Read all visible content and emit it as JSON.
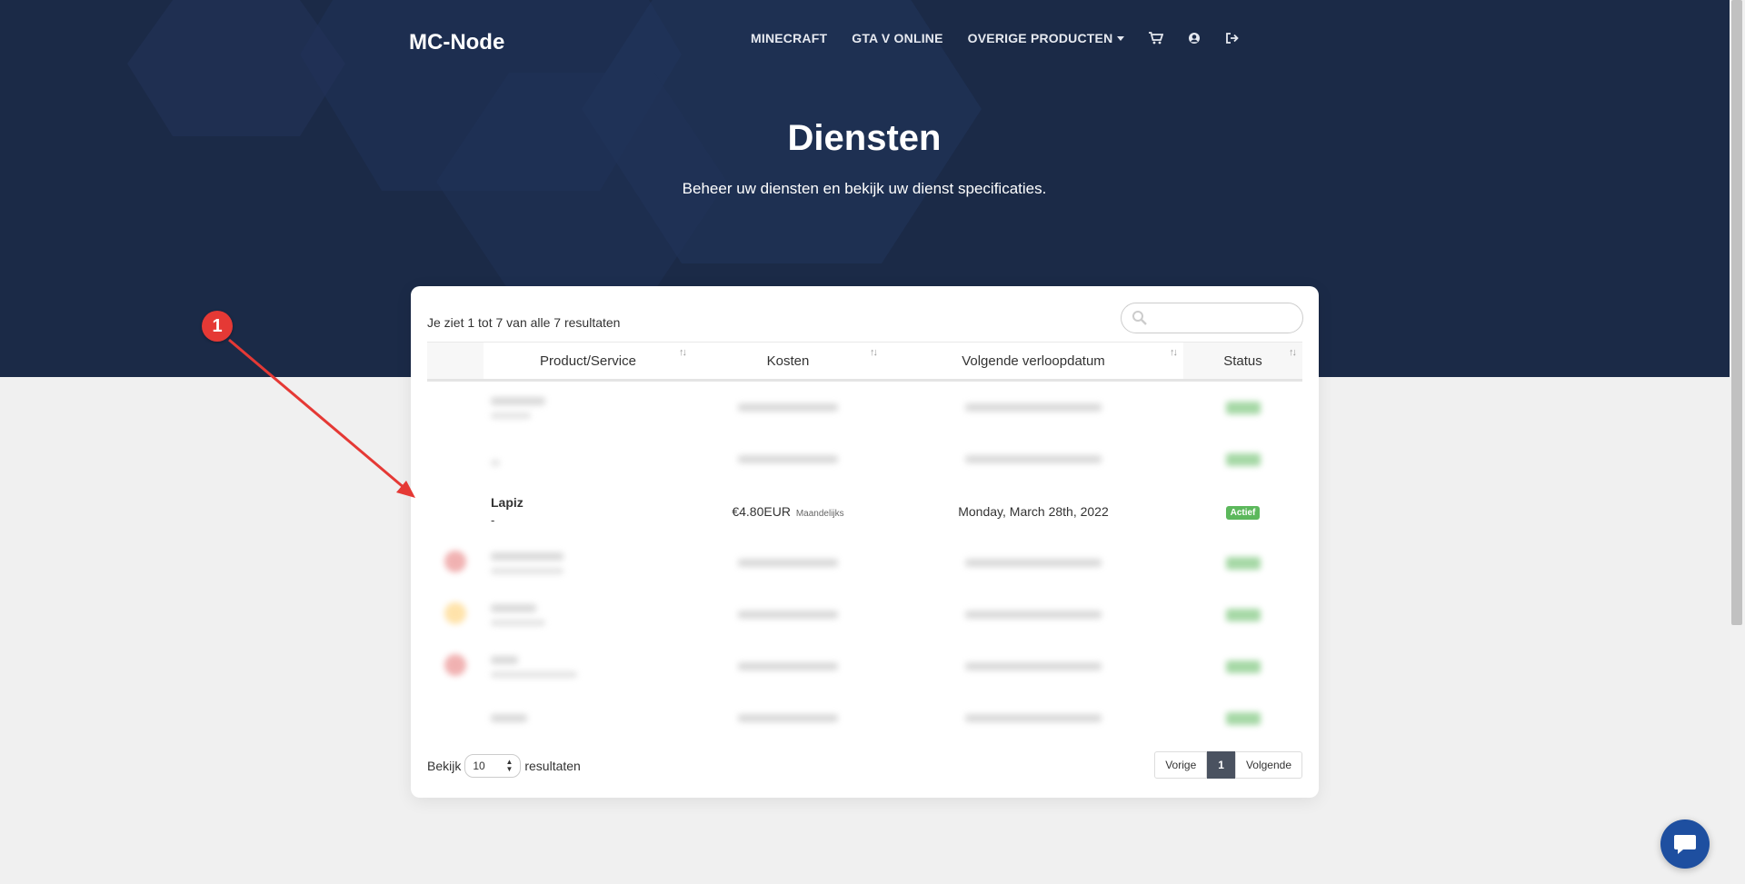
{
  "brand": "MC-Node",
  "nav": {
    "minecraft": "MINECRAFT",
    "gta": "GTA V ONLINE",
    "other": "OVERIGE PRODUCTEN",
    "icons": [
      "cart-icon",
      "user-circle-icon",
      "logout-icon"
    ]
  },
  "hero": {
    "title": "Diensten",
    "subtitle": "Beheer uw diensten en bekijk uw dienst specificaties."
  },
  "table": {
    "info": "Je ziet 1 tot 7 van alle 7 resultaten",
    "search_placeholder": "",
    "columns": [
      "",
      "Product/Service",
      "Kosten",
      "Volgende verloopdatum",
      "Status"
    ],
    "focus_row": {
      "name": "Lapiz",
      "sub": "-",
      "amount": "€4.80EUR",
      "cycle": "Maandelijks",
      "date": "Monday, March 28th, 2022",
      "status": "Actief"
    }
  },
  "footer": {
    "show_label": "Bekijk",
    "page_length": "10",
    "results_label": "resultaten",
    "prev": "Vorige",
    "current_page": "1",
    "next": "Volgende"
  },
  "annotation": {
    "marker": "1"
  },
  "colors": {
    "hero_bg": "#1b2a47",
    "page_bg": "#f0f0f0",
    "badge_green": "#5cb85c",
    "annotation_red": "#e53935",
    "chat_blue": "#1e4fa0"
  }
}
